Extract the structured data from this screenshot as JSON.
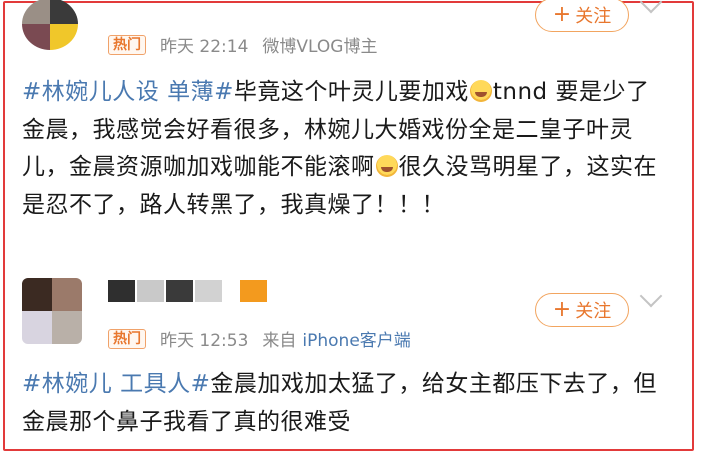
{
  "post1": {
    "badge": "热门",
    "time": "昨天 22:14",
    "source": "微博VLOG博主",
    "follow_label": "关注",
    "follow_plus": "+",
    "hashtag": "#林婉儿人设 单薄#",
    "text_a": "毕竟这个叶灵儿要加戏",
    "text_b": "tnnd 要是少了金晨，我感觉会好看很多，林婉儿大婚戏份全是二皇子叶灵儿，金晨资源咖加戏咖能不能滚啊",
    "text_c": "很久没骂明星了，这实在是忍不了，路人转黑了，我真燥了！！！",
    "emoji_name": "laugh-cry-emoji",
    "avatar_colors": [
      "#9a8f86",
      "#3a3a3a",
      "#7a4a52",
      "#f0c72a"
    ]
  },
  "post2": {
    "badge": "热门",
    "time": "昨天 12:53",
    "from_label": "来自",
    "device": "iPhone客户端",
    "follow_label": "关注",
    "follow_plus": "+",
    "hashtag": "#林婉儿 工具人#",
    "text": "金晨加戏加太猛了，给女主都压下去了，但金晨那个鼻子我看了真的很难受",
    "avatar_colors": [
      "#3b2a22",
      "#9b7a6a",
      "#d8d4e0",
      "#b9b0a8"
    ],
    "name_blur_colors": [
      "#2f2f2f",
      "#c9c9c9",
      "#3a3a3a",
      "#d2d2d2",
      "#f39a1e"
    ]
  },
  "colors": {
    "frame": "#e23a3a",
    "accent": "#e8772e",
    "link": "#4a79b0",
    "meta": "#8a8a8a"
  }
}
